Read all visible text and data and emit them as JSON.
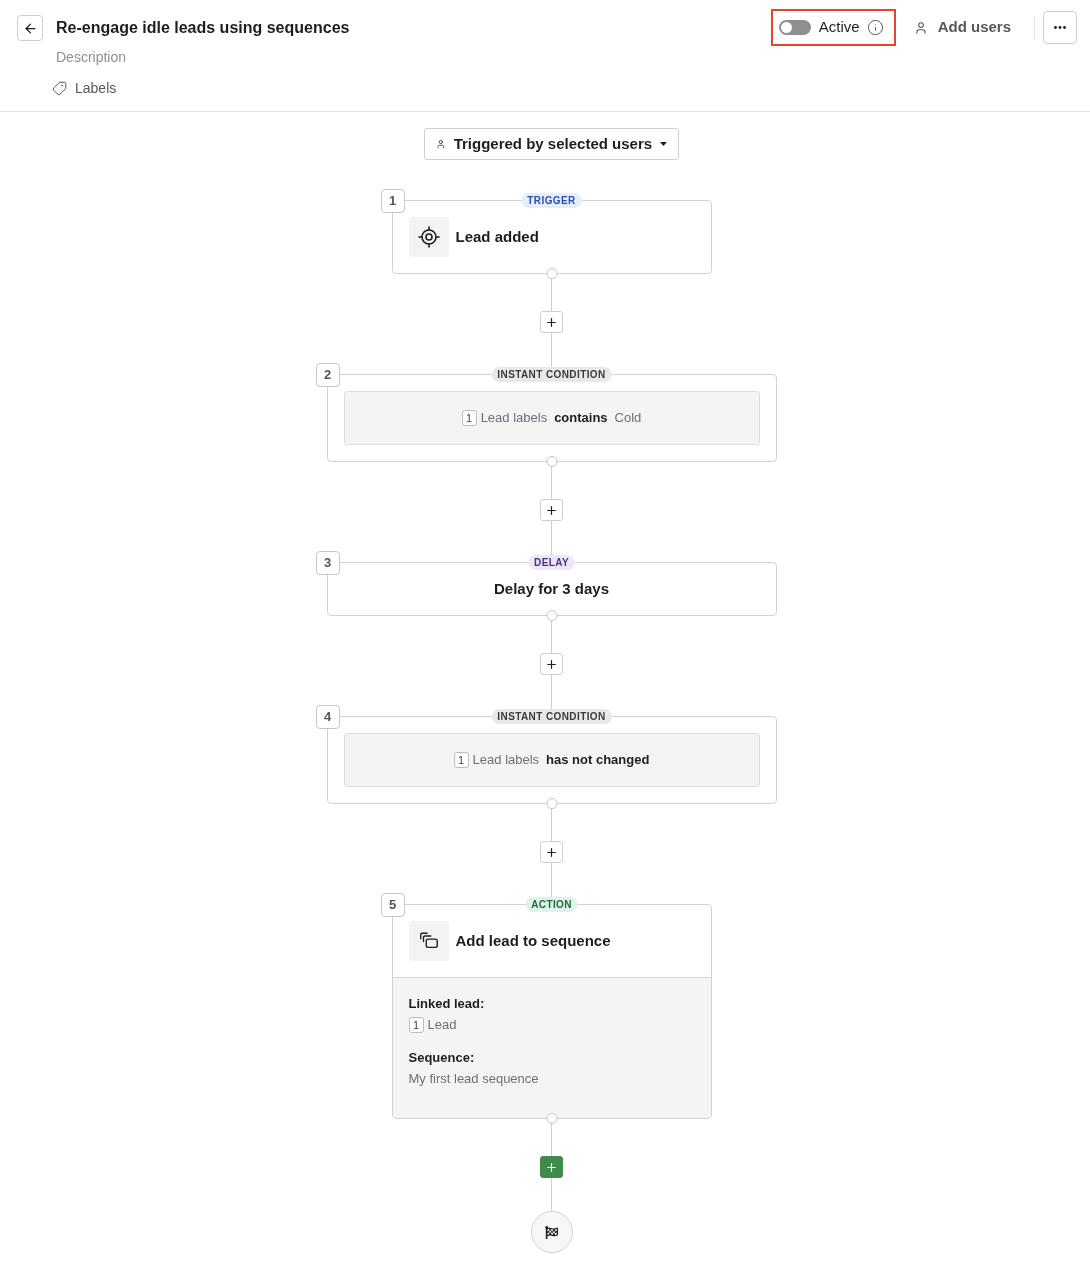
{
  "header": {
    "title": "Re-engage idle leads using sequences",
    "description": {
      "placeholder": "Description"
    },
    "labels_button": "Labels"
  },
  "status_toggle": {
    "label": "Active",
    "on": false,
    "highlighted": true
  },
  "add_users_button": "Add users",
  "trigger_selector": "Triggered by selected users",
  "steps": [
    {
      "number": "1",
      "kind": "trigger",
      "tag": "TRIGGER",
      "title": "Lead added"
    },
    {
      "number": "2",
      "kind": "condition",
      "tag": "INSTANT CONDITION",
      "condition": {
        "ref": "1",
        "field": "Lead labels",
        "operator": "contains",
        "value": "Cold"
      }
    },
    {
      "number": "3",
      "kind": "delay",
      "tag": "DELAY",
      "title": "Delay for 3 days"
    },
    {
      "number": "4",
      "kind": "condition",
      "tag": "INSTANT CONDITION",
      "condition": {
        "ref": "1",
        "field": "Lead labels",
        "operator": "has not changed"
      }
    },
    {
      "number": "5",
      "kind": "action",
      "tag": "ACTION",
      "title": "Add lead to sequence",
      "details": [
        {
          "label": "Linked lead:",
          "ref": "1",
          "value": "Lead"
        },
        {
          "label": "Sequence:",
          "value": "My first lead sequence"
        }
      ]
    }
  ],
  "add_buttons": [
    {
      "primary": false
    },
    {
      "primary": false
    },
    {
      "primary": false
    },
    {
      "primary": false
    },
    {
      "primary": true
    }
  ]
}
